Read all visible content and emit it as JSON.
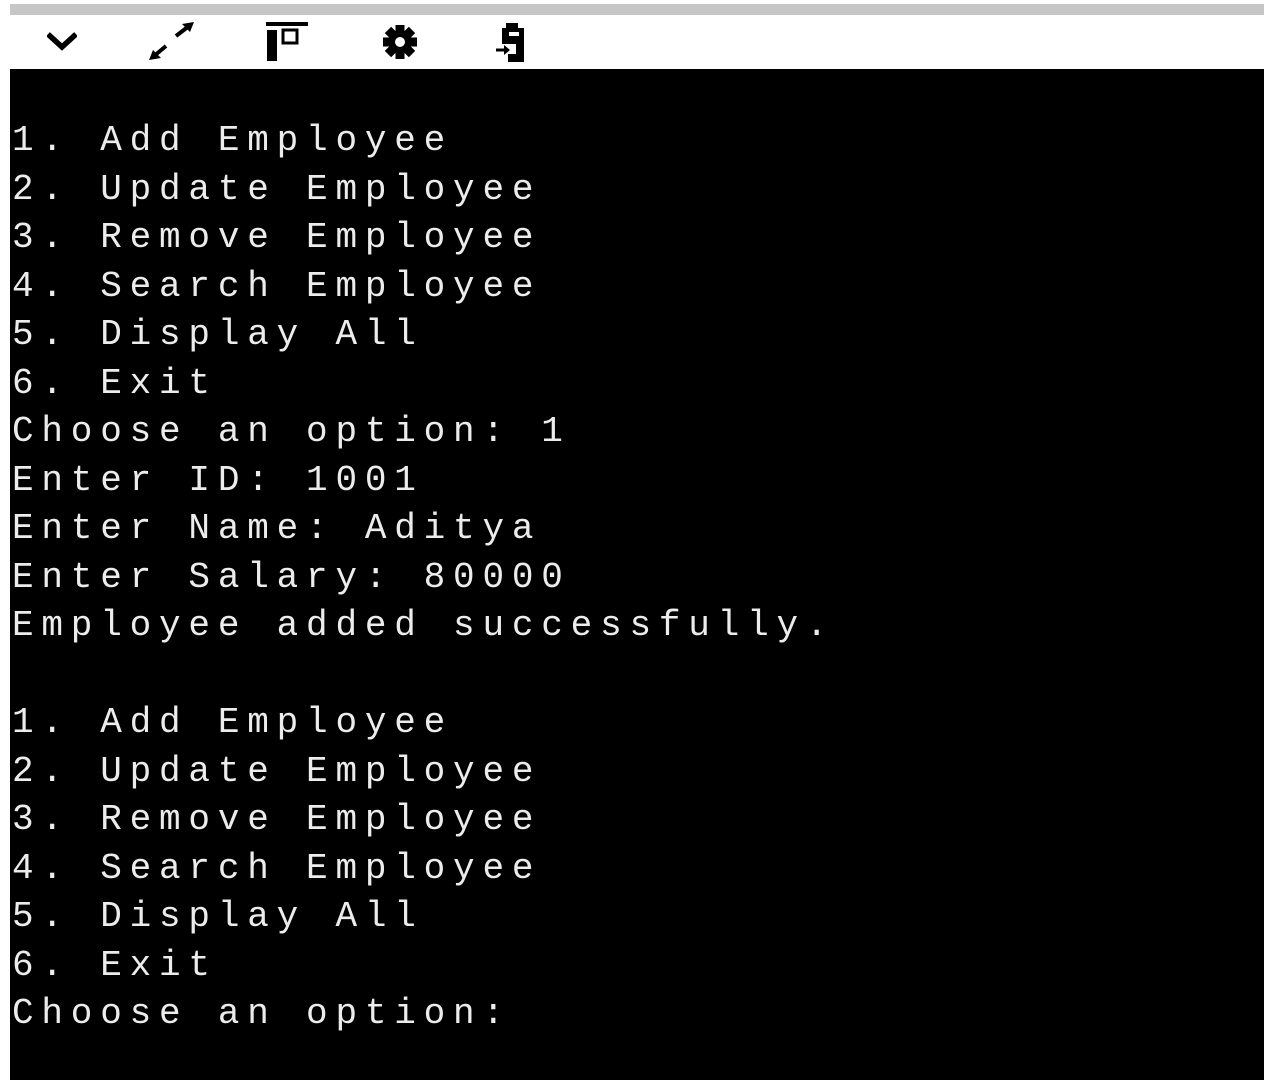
{
  "toolbar": {
    "buttons": [
      {
        "name": "collapse",
        "icon": "chevron-down-icon"
      },
      {
        "name": "expand",
        "icon": "expand-arrows-icon"
      },
      {
        "name": "layout",
        "icon": "panel-layout-icon"
      },
      {
        "name": "settings",
        "icon": "gear-icon"
      },
      {
        "name": "send",
        "icon": "clipboard-import-icon"
      }
    ]
  },
  "console": {
    "lines": [
      "1. Add Employee",
      "2. Update Employee",
      "3. Remove Employee",
      "4. Search Employee",
      "5. Display All",
      "6. Exit",
      "Choose an option: 1",
      "Enter ID: 1001",
      "Enter Name: Aditya",
      "Enter Salary: 80000",
      "Employee added successfully.",
      "",
      "1. Add Employee",
      "2. Update Employee",
      "3. Remove Employee",
      "4. Search Employee",
      "5. Display All",
      "6. Exit",
      "Choose an option:"
    ]
  },
  "colors": {
    "console_background": "#000000",
    "console_text": "#ececec",
    "toolbar_background": "#ffffff",
    "top_strip": "#c6c6c6",
    "icon": "#000000"
  }
}
